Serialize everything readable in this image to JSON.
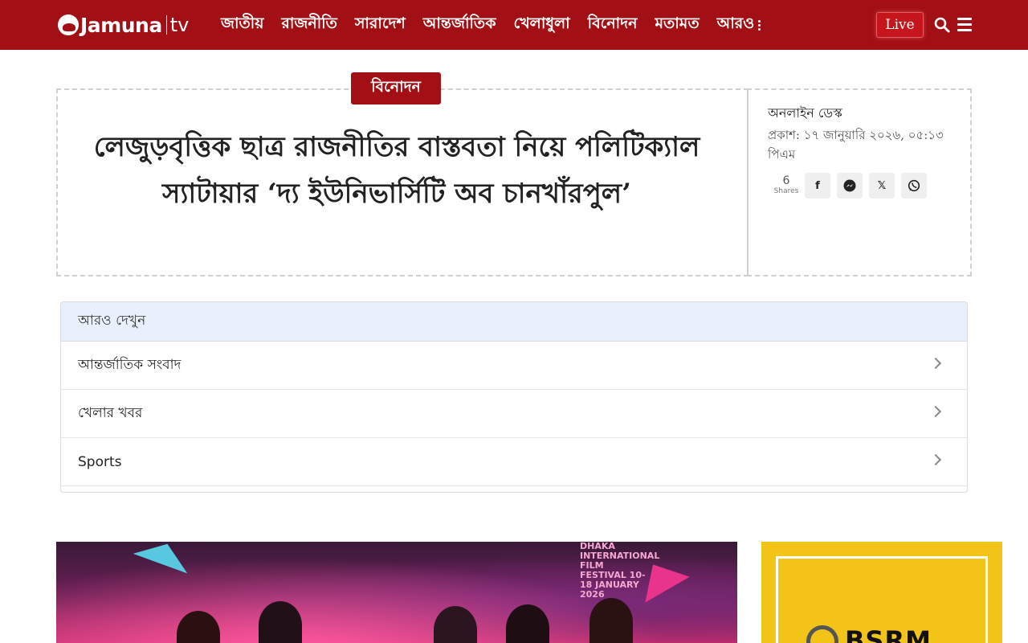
{
  "header": {
    "logo_text": "Jamuna",
    "logo_tv": "tv",
    "nav": [
      {
        "label": "জাতীয়"
      },
      {
        "label": "রাজনীতি"
      },
      {
        "label": "সারাদেশ"
      },
      {
        "label": "আন্তর্জাতিক"
      },
      {
        "label": "খেলাধুলা"
      },
      {
        "label": "বিনোদন"
      },
      {
        "label": "মতামত"
      }
    ],
    "more_label": "আরও",
    "live_label": "Live",
    "search_icon": "search-icon",
    "menu_icon": "hamburger-menu-icon"
  },
  "article": {
    "category": "বিনোদন",
    "headline": "লেজুড়বৃত্তিক ছাত্র রাজনীতির বাস্তবতা নিয়ে পলিটিক্যাল স্যাটায়ার ‘দ্য ইউনিভার্সিটি অব চানখাঁরপুল’",
    "author": "অনলাইন ডেস্ক",
    "published": "প্রকাশ: ১৭ জানুয়ারি ২০২৬, ০৫:১৩ পিএম",
    "shares_count": "6",
    "shares_label": "Shares",
    "share_buttons": [
      {
        "icon": "facebook-icon",
        "glyph": "f"
      },
      {
        "icon": "messenger-icon",
        "glyph": "m"
      },
      {
        "icon": "x-icon",
        "glyph": "𝕏"
      },
      {
        "icon": "whatsapp-icon",
        "glyph": "w"
      }
    ]
  },
  "more": {
    "title": "আরও দেখুন",
    "items": [
      {
        "label": "আন্তর্জাতিক সংবাদ"
      },
      {
        "label": "খেলার খবর"
      },
      {
        "label": "Sports"
      }
    ]
  },
  "media": {
    "image_text": "DHAKA INTERNATIONAL FILM FESTIVAL 10-18 JANUARY 2026"
  },
  "ad": {
    "brand": "BSRM"
  },
  "colors": {
    "brand_red": "#a20f14",
    "live_red": "#c4161c",
    "more_header_bg": "#e8f0fb",
    "ad_yellow": "#f2c417"
  }
}
